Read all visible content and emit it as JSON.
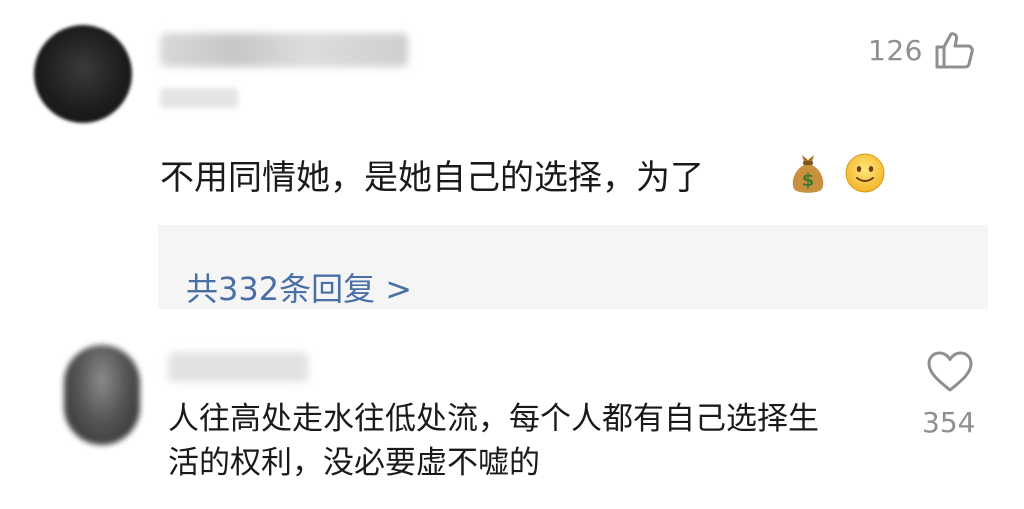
{
  "comments": [
    {
      "likes": "126",
      "like_icon": "thumbs-up-icon",
      "text": "不用同情她，是她自己的选择，为了",
      "emojis": [
        "money-bag-emoji",
        "smiling-face-emoji"
      ],
      "replies_link": "共332条回复 >"
    },
    {
      "likes": "354",
      "like_icon": "heart-icon",
      "text_line1": "人往高处走水往低处流，每个人都有自己选择生",
      "text_line2": "活的权利，没必要虚不嘘的"
    }
  ],
  "colors": {
    "link": "#4a6fa5",
    "muted": "#8f8f8f",
    "reply_background": "#f5f5f5"
  }
}
